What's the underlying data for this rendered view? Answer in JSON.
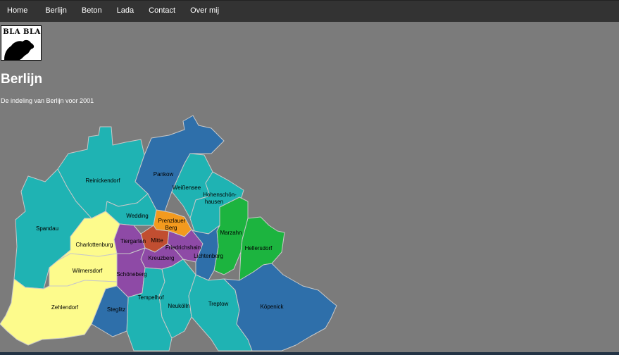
{
  "nav": {
    "items": [
      "Home",
      "Berlijn",
      "Beton",
      "Lada",
      "Contact",
      "Over mij"
    ]
  },
  "logo": {
    "text": "BLA BLA"
  },
  "page": {
    "title": "Berlijn",
    "subtitle": "De indeling van Berlijn voor 2001"
  },
  "map": {
    "labels": {
      "reinickendorf": "Reinickendorf",
      "pankow": "Pankow",
      "weissensee": "Weißensee",
      "hohenschoenhausen_1": "Hohenschön-",
      "hohenschoenhausen_2": "hausen",
      "spandau": "Spandau",
      "wedding": "Wedding",
      "prenzlauer_1": "Prenzlauer",
      "prenzlauer_2": "Berg",
      "marzahn": "Marzahn",
      "hellersdorf": "Hellersdorf",
      "charlottenburg": "Charlottenburg",
      "tiergarten": "Tiergarten",
      "mitte": "Mitte",
      "friedrichshain": "Friedrichshain",
      "lichtenberg": "Lichtenberg",
      "kreuzberg": "Kreuzberg",
      "wilmersdorf": "Wilmersdorf",
      "schoeneberg": "Schöneberg",
      "tempelhof": "Tempelhof",
      "zehlendorf": "Zehlendorf",
      "steglitz": "Steglitz",
      "neukoelln": "Neukölln",
      "treptow": "Treptow",
      "koepenick": "Köpenick"
    },
    "colors": {
      "teal": "#1fb3b3",
      "blue": "#2e6faa",
      "green": "#1cb43f",
      "yellow": "#fdfb8c",
      "purple": "#8e4aa6",
      "orange": "#f39a1e",
      "red": "#c14e31"
    }
  }
}
